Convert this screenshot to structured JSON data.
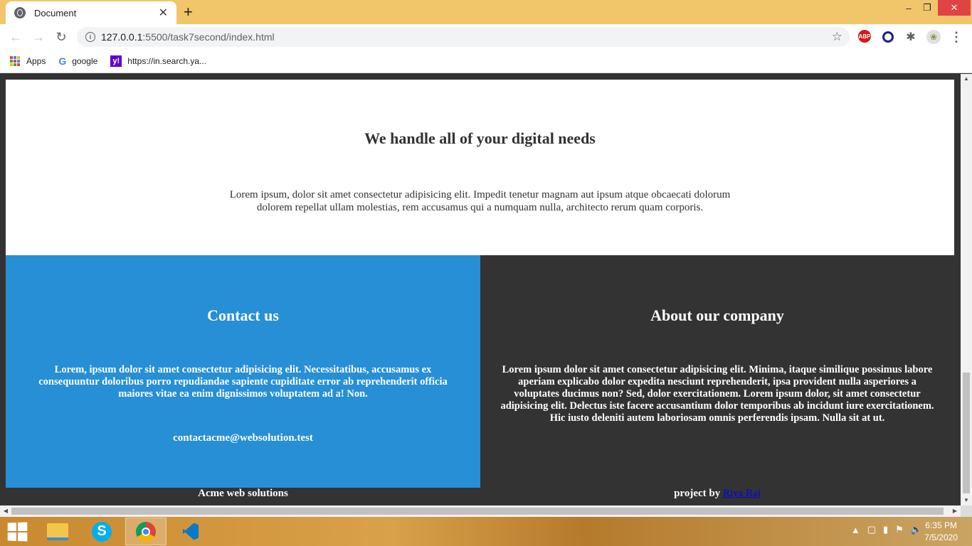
{
  "browser": {
    "tab_title": "Document",
    "tab_close": "✕",
    "new_tab": "+",
    "window_controls": {
      "minimize": "–",
      "restore": "❐",
      "close": "✕"
    },
    "nav": {
      "back": "←",
      "forward": "→",
      "reload": "↻"
    },
    "url_host": "127.0.0.1",
    "url_path": ":5500/task7second/index.html",
    "star": "☆",
    "extensions": {
      "abp": "ABP",
      "puzzle": "✱",
      "profile": "❀",
      "menu": "⋮"
    },
    "bookmarks": [
      {
        "label": "Apps"
      },
      {
        "label": "google"
      },
      {
        "label": "https://in.search.ya..."
      }
    ]
  },
  "page": {
    "hero": {
      "heading": "We handle all of your digital needs",
      "text": "Lorem ipsum, dolor sit amet consectetur adipisicing elit. Impedit tenetur magnam aut ipsum atque obcaecati dolorum dolorem repellat ullam molestias, rem accusamus qui a numquam nulla, architecto rerum quam corporis."
    },
    "contact": {
      "heading": "Contact us",
      "text": "Lorem, ipsum dolor sit amet consectetur adipisicing elit. Necessitatibus, accusamus ex consequuntur doloribus porro repudiandae sapiente cupiditate error ab reprehenderit officia maiores vitae ea enim dignissimos voluptatem ad a! Non.",
      "email": "contactacme@websolution.test"
    },
    "about": {
      "heading": "About our company",
      "text": "Lorem ipsum dolor sit amet consectetur adipisicing elit. Minima, itaque similique possimus labore aperiam explicabo dolor expedita nesciunt reprehenderit, ipsa provident nulla asperiores a voluptates ducimus non? Sed, dolor exercitationem. Lorem ipsum dolor, sit amet consectetur adipisicing elit. Delectus iste facere accusantium dolor temporibus ab incidunt iure exercitationem. Hic iusto deleniti autem laboriosam omnis perferendis ipsam. Nulla sit at ut."
    },
    "footer": {
      "left": "Acme web solutions",
      "right_prefix": "project by ",
      "right_link": "Riya Raj"
    }
  },
  "taskbar": {
    "time": "6:35 PM",
    "date": "7/5/2020"
  },
  "colors": {
    "tabstrip": "#f1c66a",
    "contact_bg": "#268fd6",
    "dark_bg": "#333333"
  }
}
